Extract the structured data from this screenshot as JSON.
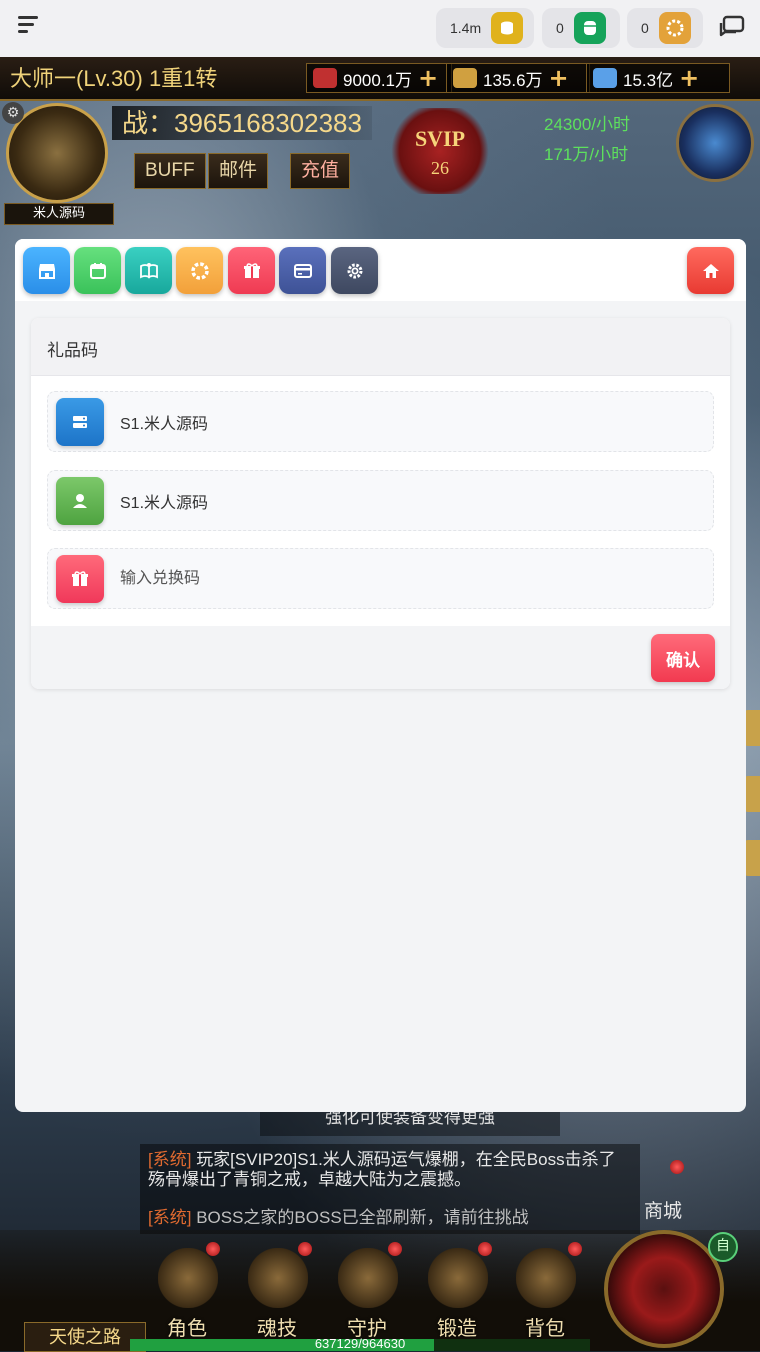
{
  "topbar": {
    "currencies": [
      {
        "value": "1.4m",
        "icon": "coin-stack-icon",
        "color": "#e0b21c"
      },
      {
        "value": "0",
        "icon": "cylinder-icon",
        "color": "#16a35a"
      },
      {
        "value": "0",
        "icon": "sun-badge-icon",
        "color": "#e3a23a"
      }
    ]
  },
  "game": {
    "player_title": "大师一(Lv.30) 1重1转",
    "resources": [
      "9000.1万",
      "135.6万",
      "15.3亿"
    ],
    "power": "战：3965168302383",
    "buttons": [
      "BUFF",
      "邮件",
      "充值"
    ],
    "svip_label": "SVIP",
    "svip_level": "26",
    "rates": [
      "24300/小时",
      "171万/小时"
    ],
    "avatar_name": "米人源码",
    "tip": "强化可使装备变得更强",
    "chat": [
      {
        "tag": "[系统]",
        "text": "玩家[SVIP20]S1.米人源码运气爆棚，在全民Boss击杀了殇骨爆出了青铜之戒，卓越大陆为之震撼。"
      },
      {
        "tag": "[系统]",
        "text": "BOSS之家的BOSS已全部刷新，请前往挑战"
      }
    ],
    "shop": "商城",
    "nav": [
      "角色",
      "魂技",
      "守护",
      "锻造",
      "背包"
    ],
    "angel_road": "天使之路",
    "xp_text": "637129/964630",
    "xp_fraction": 0.66,
    "auto": "自"
  },
  "modal": {
    "toolbar_icons": [
      {
        "name": "store-icon",
        "color": "#3aa0f0"
      },
      {
        "name": "calendar-icon",
        "color": "#4ccf6a"
      },
      {
        "name": "book-icon",
        "color": "#25bdb0"
      },
      {
        "name": "wheel-icon",
        "color": "#f7b24a"
      },
      {
        "name": "gift-icon",
        "color": "#f5485e"
      },
      {
        "name": "card-icon",
        "color": "#4a5fa8"
      },
      {
        "name": "gear-icon",
        "color": "#4a5570"
      }
    ],
    "home_icon": {
      "name": "home-icon",
      "color": "#f24c45"
    },
    "card_title": "礼品码",
    "rows": [
      {
        "icon": "server-icon",
        "color": "#2a86d8",
        "text": "S1.米人源码"
      },
      {
        "icon": "user-icon",
        "color": "#5fb453",
        "text": "S1.米人源码"
      }
    ],
    "redeem": {
      "icon": "gift-icon",
      "color": "#f5485e",
      "placeholder": "输入兑换码"
    },
    "confirm_label": "确认"
  }
}
